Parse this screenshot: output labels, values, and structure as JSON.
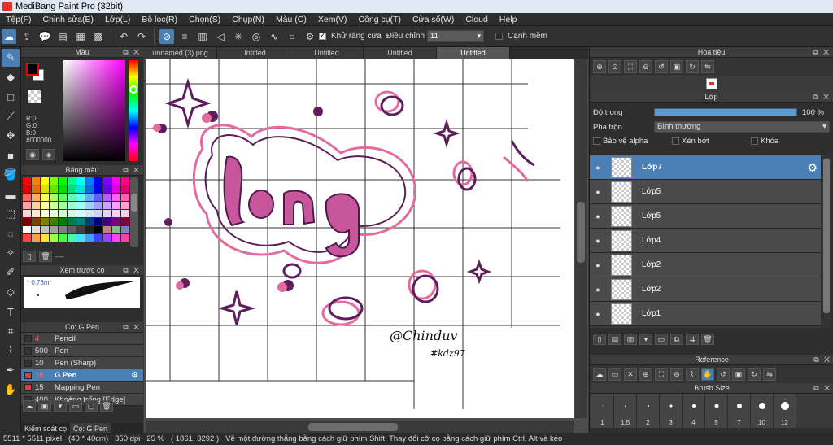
{
  "window": {
    "title": "MediBang Paint Pro (32bit)"
  },
  "menu": [
    "Tệp(F)",
    "Chỉnh sửa(E)",
    "Lớp(L)",
    "Bộ lọc(R)",
    "Chọn(S)",
    "Chụp(N)",
    "Màu (C)",
    "Xem(V)",
    "Công cụ(T)",
    "Cửa sổ(W)",
    "Cloud",
    "Help"
  ],
  "toolbar": {
    "antialias_label": "Khử răng cưa",
    "correction_label": "Điều chỉnh",
    "correction_value": "11",
    "snap_label": "Cạnh mềm"
  },
  "color_panel": {
    "title": "Màu",
    "r": "R:0",
    "g": "G:0",
    "b": "B:0",
    "hex": "#000000"
  },
  "palette_panel": {
    "title": "Bảng màu",
    "footer": "----"
  },
  "preview_panel": {
    "title": "Xem trước cọ",
    "size": "* 0.73mr"
  },
  "brush_panel": {
    "title": "Cọ: G Pen",
    "items": [
      {
        "size": "4",
        "name": "Pencil",
        "color": "#333333",
        "size_color": "#ff6060"
      },
      {
        "size": "500",
        "name": "Pen",
        "color": "#333333",
        "size_color": "#dddddd"
      },
      {
        "size": "10",
        "name": "Pen (Sharp)",
        "color": "#333333",
        "size_color": "#dddddd"
      },
      {
        "size": "10",
        "name": "G Pen",
        "color": "#e43c3c",
        "size_color": "#ff6060"
      },
      {
        "size": "15",
        "name": "Mapping Pen",
        "color": "#e43c3c",
        "size_color": "#dddddd"
      },
      {
        "size": "400",
        "name": "Khoảng trống [Edge]",
        "color": "#333333",
        "size_color": "#dddddd"
      }
    ]
  },
  "bottom_tabs": [
    "Kiểm soát cọ",
    "Cọ: G Pen"
  ],
  "doc_tabs": [
    "unnamed (3).png",
    "Untitled",
    "Untitled",
    "Untitled",
    "Untitled"
  ],
  "canvas": {
    "title_text": "Long",
    "signature": "@Chinduv",
    "hashtag": "#kdz97"
  },
  "navigator": {
    "title": "Hoa tiêu"
  },
  "layer_panel": {
    "title": "Lớp",
    "opacity_label": "Độ trong",
    "opacity_value": "100 %",
    "blend_label": "Pha trộn",
    "blend_value": "Bình thường",
    "protect_alpha": "Bảo vệ alpha",
    "clipping": "Xén bớt",
    "lock": "Khóa",
    "layers": [
      "Lớp7",
      "Lớp5",
      "Lớp5",
      "Lớp4",
      "Lớp2",
      "Lớp2",
      "Lớp1"
    ]
  },
  "reference_panel": {
    "title": "Reference"
  },
  "brushsize_panel": {
    "title": "Brush Size",
    "sizes": [
      "1",
      "1.5",
      "2",
      "3",
      "4",
      "5",
      "7",
      "10",
      "12"
    ]
  },
  "status": {
    "dims": "5511 * 5511 pixel",
    "cm": "(40 * 40cm)",
    "dpi": "350 dpi",
    "zoom": "25 %",
    "coords": "( 1861, 3292 )",
    "hint": "Vẽ một đường thẳng bằng cách giữ phím Shift, Thay đổi cỡ cọ bằng cách giữ phím Ctrl, Alt và kéo"
  }
}
